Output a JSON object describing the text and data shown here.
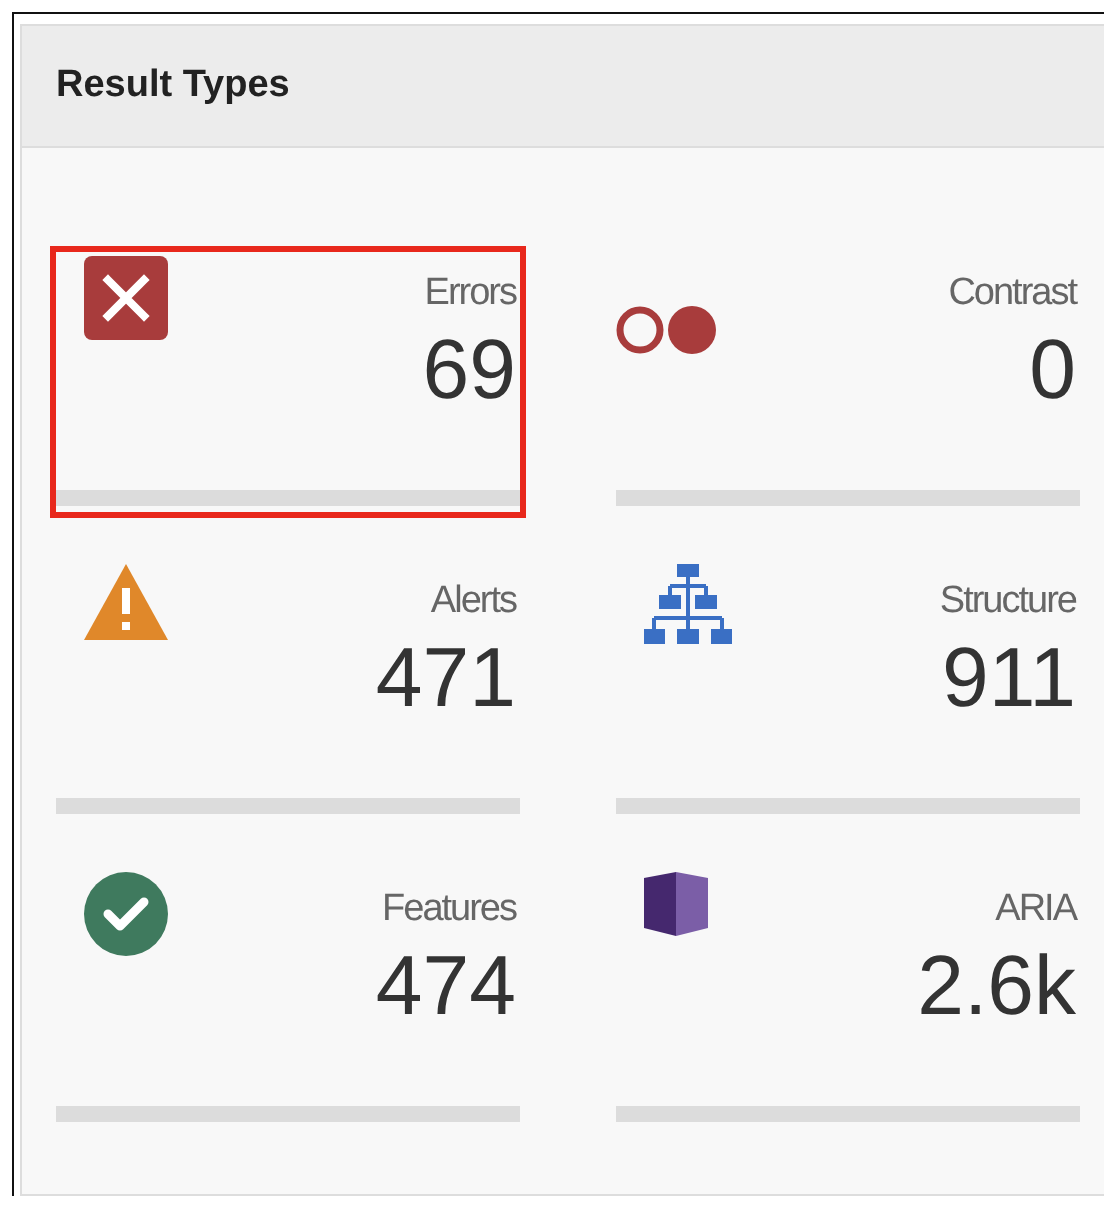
{
  "panel": {
    "title": "Result Types"
  },
  "tiles": [
    {
      "kind": "errors",
      "label": "Errors",
      "count": "69",
      "selected": true
    },
    {
      "kind": "contrast",
      "label": "Contrast",
      "count": "0",
      "selected": false
    },
    {
      "kind": "alerts",
      "label": "Alerts",
      "count": "471",
      "selected": false
    },
    {
      "kind": "structure",
      "label": "Structure",
      "count": "911",
      "selected": false
    },
    {
      "kind": "features",
      "label": "Features",
      "count": "474",
      "selected": false
    },
    {
      "kind": "aria",
      "label": "ARIA",
      "count": "2.6k",
      "selected": false
    }
  ]
}
